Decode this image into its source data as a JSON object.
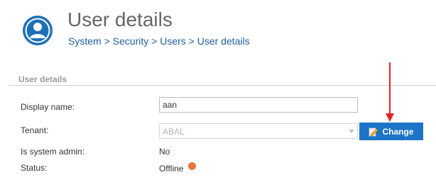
{
  "header": {
    "title": "User details",
    "breadcrumb": [
      "System",
      "Security",
      "Users",
      "User details"
    ],
    "breadcrumb_separator": ">",
    "icon": "user-avatar-icon"
  },
  "section": {
    "title": "User details"
  },
  "form": {
    "display_name_label": "Display name:",
    "display_name_value": "aan",
    "tenant_label": "Tenant:",
    "tenant_value": "ABAL",
    "change_button_label": "Change",
    "change_button_icon": "edit-icon",
    "is_system_admin_label": "Is system admin:",
    "is_system_admin_value": "No",
    "status_label": "Status:",
    "status_value": "Offline",
    "status_icon": "status-dot-icon"
  },
  "colors": {
    "accent": "#1c74c6",
    "breadcrumb": "#1f5f9e",
    "status_offline": "#e8763a",
    "annotation_arrow": "#e32222"
  }
}
